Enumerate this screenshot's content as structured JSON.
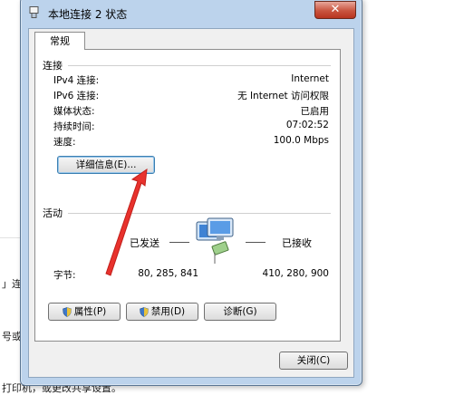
{
  "background": {
    "fragment_1": "」连",
    "fragment_2": "号或",
    "fragment_3": "打印机，或更改共享设置。"
  },
  "window": {
    "title": "本地连接 2 状态",
    "close_label": "✕"
  },
  "tab_label": "常规",
  "connection": {
    "section_title": "连接",
    "rows": [
      {
        "label": "IPv4 连接:",
        "value": "Internet"
      },
      {
        "label": "IPv6 连接:",
        "value": "无 Internet 访问权限"
      },
      {
        "label": "媒体状态:",
        "value": "已启用"
      },
      {
        "label": "持续时间:",
        "value": "07:02:52"
      },
      {
        "label": "速度:",
        "value": "100.0 Mbps"
      }
    ],
    "details_button": "详细信息(E)..."
  },
  "activity": {
    "section_title": "活动",
    "sent_label": "已发送",
    "received_label": "已接收",
    "bytes_label": "字节:",
    "bytes_sent": "80, 285, 841",
    "bytes_received": "410, 280, 900"
  },
  "buttons": {
    "properties": "属性(P)",
    "disable": "禁用(D)",
    "diagnose": "诊断(G)",
    "close": "关闭(C)"
  },
  "colors": {
    "annotation_arrow": "#e8322d",
    "window_frame": "#bcd3ec",
    "close_button": "#c9543f"
  }
}
